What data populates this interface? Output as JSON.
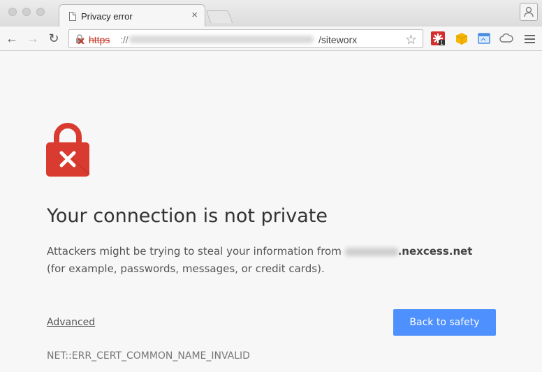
{
  "browser": {
    "tab": {
      "title": "Privacy error",
      "close_icon": "×"
    },
    "address_bar": {
      "scheme": "https",
      "separator": "://",
      "path": "/siteworx"
    },
    "extensions": [
      {
        "name": "lastpass-icon",
        "badge": "1",
        "color": "#d32f2f"
      },
      {
        "name": "package-icon",
        "color": "#f5b400"
      },
      {
        "name": "window-icon",
        "color": "#4a8fe0"
      },
      {
        "name": "cloud-icon",
        "color": "#777777"
      }
    ]
  },
  "page": {
    "heading": "Your connection is not private",
    "message_line1_prefix": "Attackers might be trying to steal your information from ",
    "domain_suffix": ".nexcess.net",
    "message_line2": "(for example, passwords, messages, or credit cards).",
    "advanced_label": "Advanced",
    "back_button_label": "Back to safety",
    "error_code": "NET::ERR_CERT_COMMON_NAME_INVALID"
  },
  "colors": {
    "accent": "#4d90fe",
    "lock_red": "#d93b30",
    "https_red": "#c53929"
  }
}
